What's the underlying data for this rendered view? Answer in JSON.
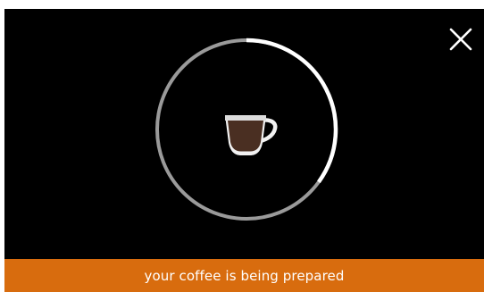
{
  "status": {
    "message": "your coffee is being prepared",
    "bar_color": "#d86c0e"
  },
  "progress": {
    "value": 0.35,
    "track_color": "#9a9a9a",
    "fill_color": "#ffffff"
  },
  "icons": {
    "cup": "coffee-cup-icon",
    "close": "close-icon"
  }
}
